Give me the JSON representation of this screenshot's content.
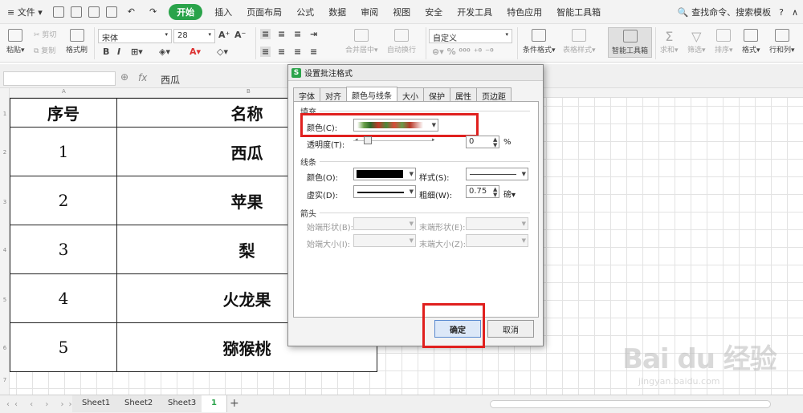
{
  "menubar": {
    "file": "文件",
    "tabs": [
      "开始",
      "插入",
      "页面布局",
      "公式",
      "数据",
      "审阅",
      "视图",
      "安全",
      "开发工具",
      "特色应用",
      "智能工具箱"
    ],
    "search": "查找命令、搜索模板",
    "help": "?"
  },
  "ribbon": {
    "paste": "粘贴",
    "cut": "剪切",
    "copy": "复制",
    "format_painter": "格式刷",
    "font_name": "宋体",
    "font_size": "28",
    "merge_center": "合并居中",
    "wrap": "自动换行",
    "number_format": "自定义",
    "conditional": "条件格式",
    "table_style": "表格样式",
    "smart_toolbox": "智能工具箱",
    "sum": "求和",
    "filter": "筛选",
    "sort": "排序",
    "format": "格式",
    "row_col": "行和列"
  },
  "formula_bar": {
    "fx": "fx",
    "content": "西瓜"
  },
  "table": {
    "headers": [
      "序号",
      "名称"
    ],
    "rows": [
      [
        "1",
        "西瓜"
      ],
      [
        "2",
        "苹果"
      ],
      [
        "3",
        "梨"
      ],
      [
        "4",
        "火龙果"
      ],
      [
        "5",
        "猕猴桃"
      ]
    ]
  },
  "row_numbers": [
    "1",
    "2",
    "3",
    "4",
    "5",
    "6",
    "7"
  ],
  "col_letters": [
    "A",
    "B"
  ],
  "sheets": {
    "tabs": [
      "Sheet1",
      "Sheet2",
      "Sheet3",
      "1"
    ],
    "add": "+"
  },
  "dialog": {
    "title": "设置批注格式",
    "logo": "S",
    "tabs": [
      "字体",
      "对齐",
      "颜色与线条",
      "大小",
      "保护",
      "属性",
      "页边距"
    ],
    "fill": {
      "section": "填充",
      "color_label": "颜色(C):",
      "transparency_label": "透明度(T):",
      "transparency_value": "0",
      "percent": "%"
    },
    "line": {
      "section": "线条",
      "color_label": "颜色(O):",
      "style_label": "样式(S):",
      "dash_label": "虚实(D):",
      "weight_label": "粗细(W):",
      "weight_value": "0.75",
      "unit": "磅"
    },
    "arrow": {
      "section": "箭头",
      "begin_style": "始端形状(B):",
      "end_style": "末端形状(E):",
      "begin_size": "始端大小(I):",
      "end_size": "末端大小(Z):"
    },
    "ok": "确定",
    "cancel": "取消"
  },
  "watermark": {
    "brand": "Bai du 经验",
    "url": "jingyan.baidu.com"
  },
  "colors": {
    "accent_green": "#2aa34a",
    "highlight_red": "#e0201e"
  }
}
